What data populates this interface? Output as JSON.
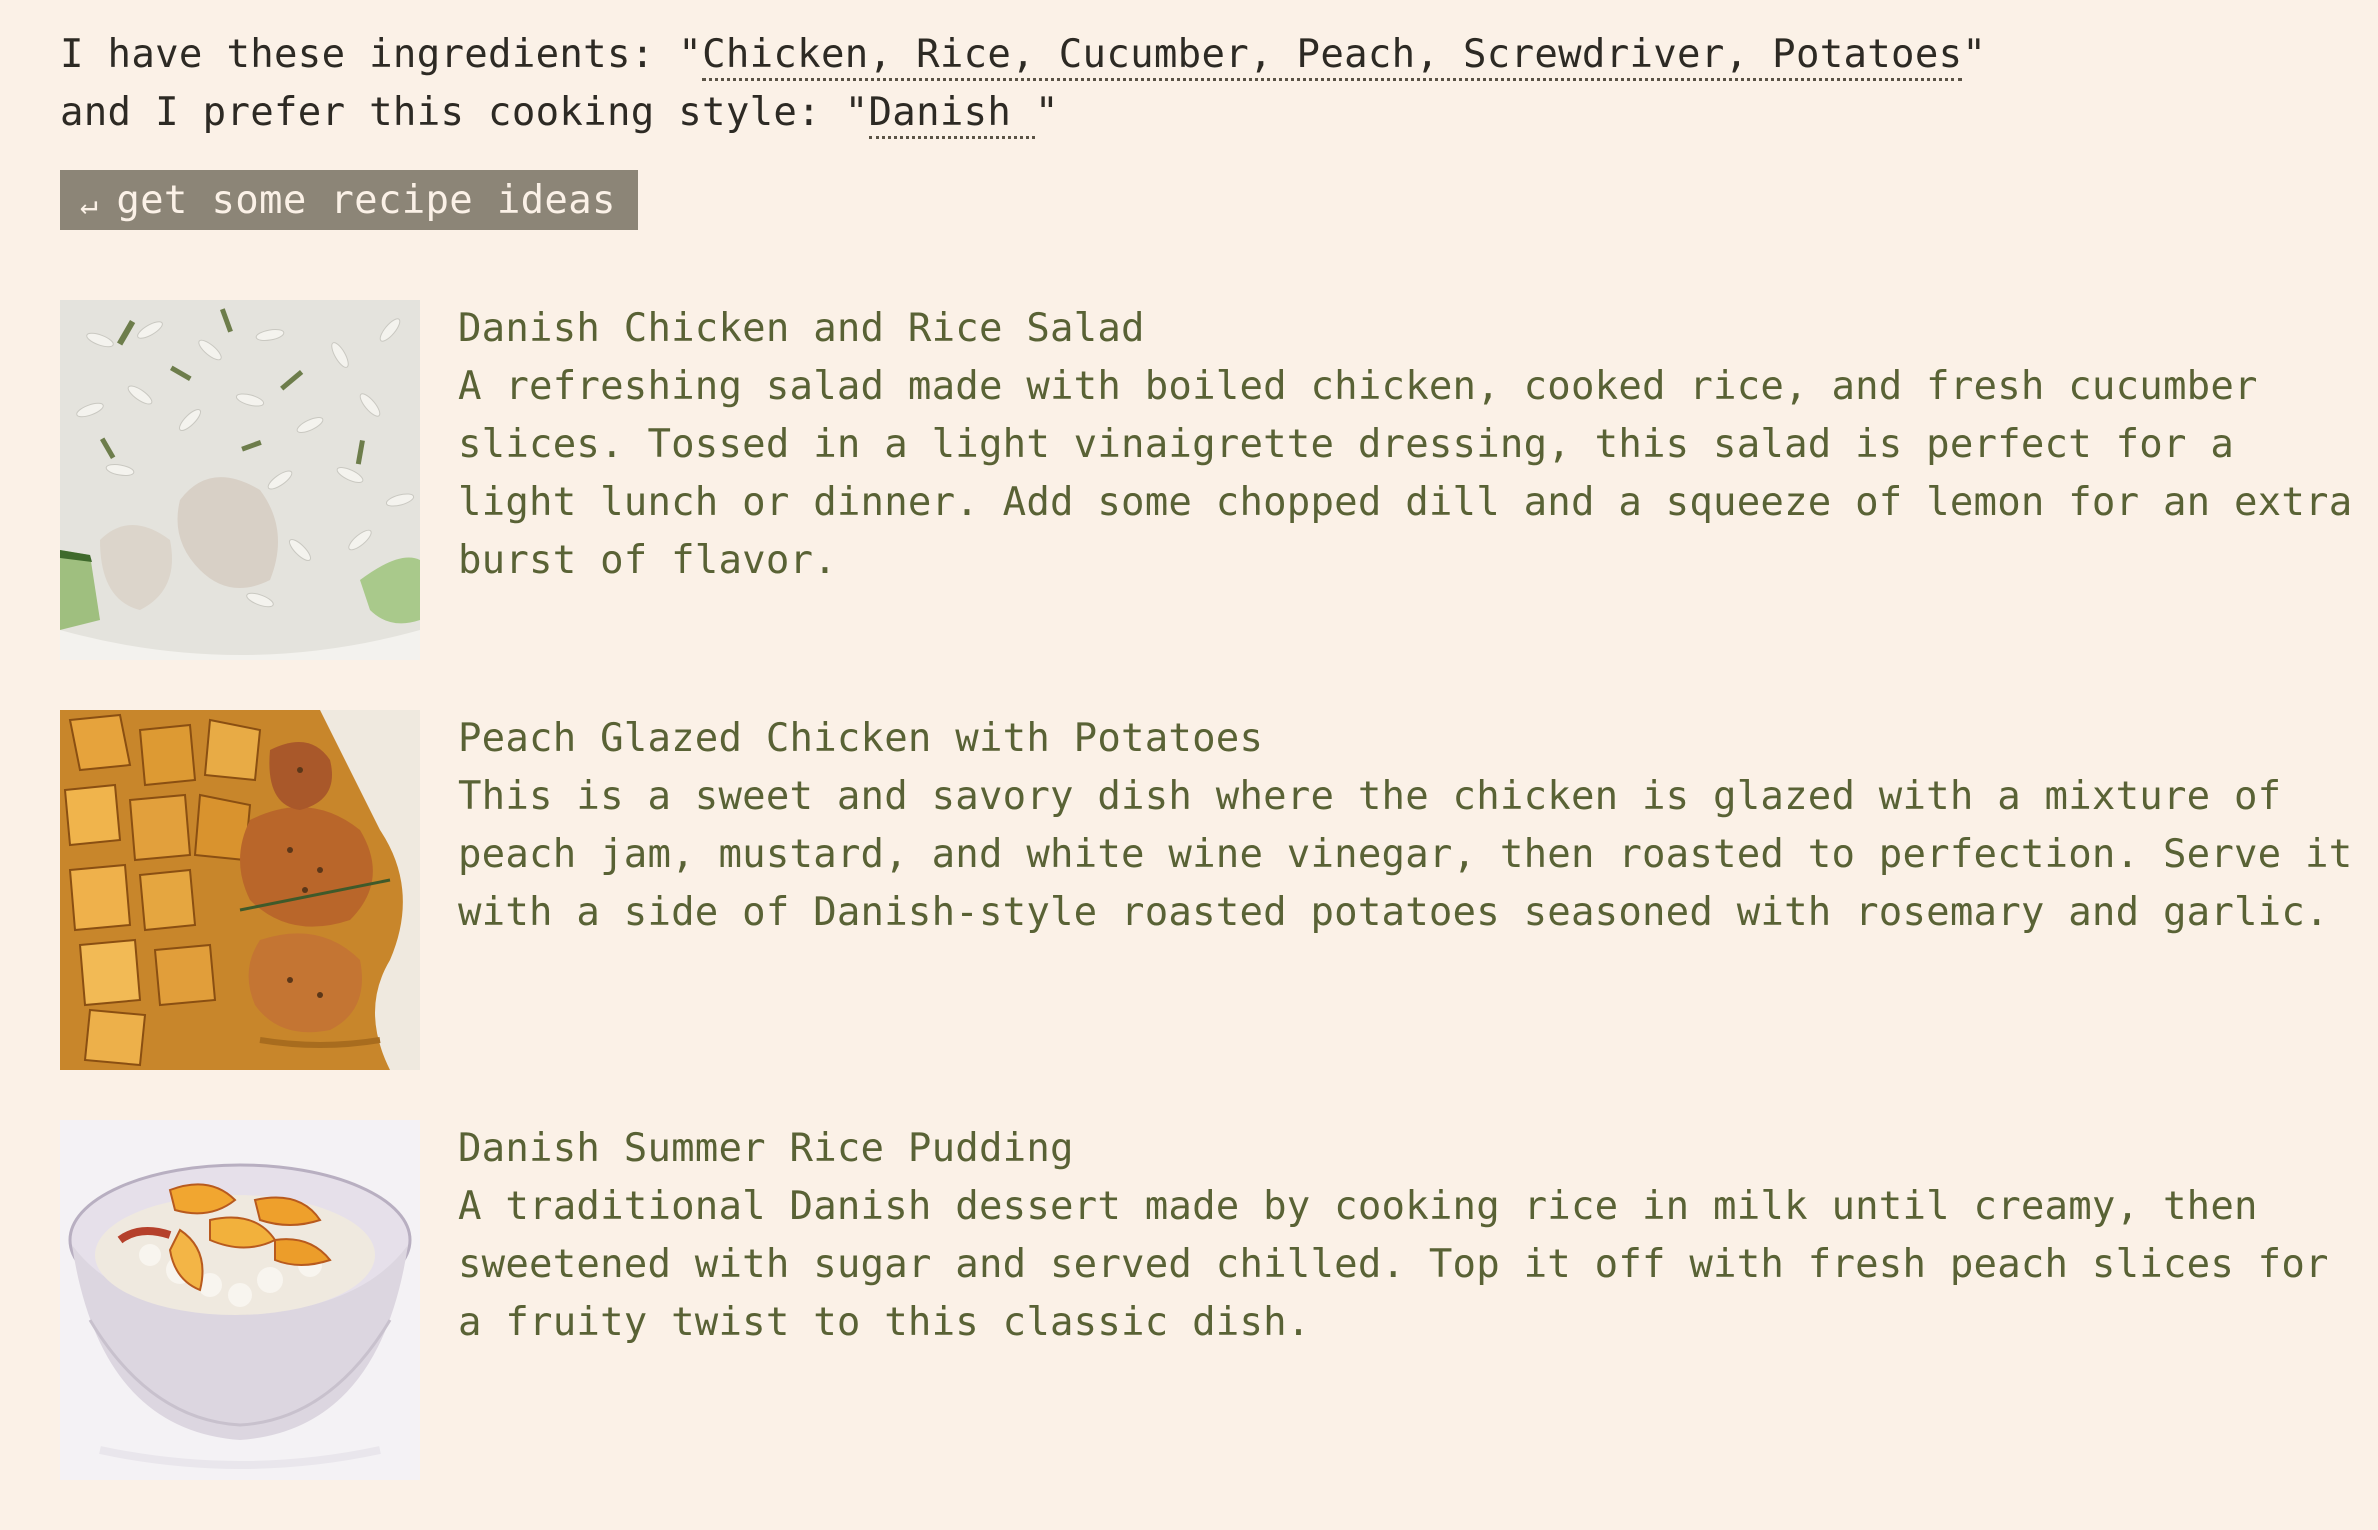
{
  "prompt": {
    "ingredients_prefix": "I have these ingredients: \"",
    "ingredients_value": "Chicken, Rice, Cucumber, Peach, Screwdriver, Potatoes",
    "ingredients_suffix": "\"",
    "style_prefix": "and I prefer this cooking style: \"",
    "style_value": "Danish ",
    "style_suffix": "\""
  },
  "submit": {
    "icon": "return-arrow-icon",
    "arrow_glyph": "↵",
    "label": "get some recipe ideas"
  },
  "recipes": [
    {
      "title": "Danish Chicken and Rice Salad",
      "description": "A refreshing salad made with boiled chicken, cooked rice, and fresh cucumber slices. Tossed in a light vinaigrette dressing, this salad is perfect for a light lunch or dinner. Add some chopped dill and a squeeze of lemon for an extra burst of flavor."
    },
    {
      "title": "Peach Glazed Chicken with Potatoes",
      "description": "This is a sweet and savory dish where the chicken is glazed with a mixture of peach jam, mustard, and white wine vinegar, then roasted to perfection. Serve it with a side of Danish-style roasted potatoes seasoned with rosemary and garlic."
    },
    {
      "title": "Danish Summer Rice Pudding",
      "description": "A traditional Danish dessert made by cooking rice in milk until creamy, then sweetened with sugar and served chilled. Top it off with fresh peach slices for a fruity twist to this classic dish."
    }
  ],
  "colors": {
    "background": "#fbf1e7",
    "text": "#2d2a24",
    "recipe_text": "#596235",
    "button_bg": "#8c8577",
    "button_text": "#fbf1e7"
  }
}
